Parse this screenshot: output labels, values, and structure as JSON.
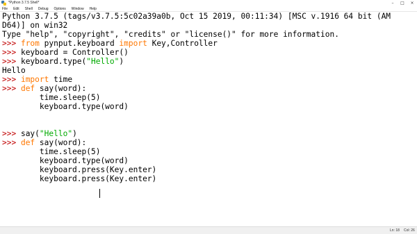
{
  "window": {
    "title": "*Python 3.7.5 Shell*"
  },
  "menu": [
    "File",
    "Edit",
    "Shell",
    "Debug",
    "Options",
    "Window",
    "Help"
  ],
  "colors": {
    "keyword": "#ff7700",
    "string": "#00aa00",
    "prompt": "#c00000",
    "output": "#000000",
    "background": "#ffffff"
  },
  "shell_lines": [
    [
      {
        "t": "Python 3.7.5 (tags/v3.7.5:5c02a39a0b, Oct 15 2019, 00:11:34) [MSC v.1916 64 bit (AM",
        "c": "normal"
      }
    ],
    [
      {
        "t": "D64)] on win32",
        "c": "normal"
      }
    ],
    [
      {
        "t": "Type \"help\", \"copyright\", \"credits\" or \"license()\" for more information.",
        "c": "normal"
      }
    ],
    [
      {
        "t": ">>> ",
        "c": "prompt"
      },
      {
        "t": "from",
        "c": "keyword"
      },
      {
        "t": " pynput.keyboard ",
        "c": "normal"
      },
      {
        "t": "import",
        "c": "keyword"
      },
      {
        "t": " Key,Controller",
        "c": "normal"
      }
    ],
    [
      {
        "t": ">>> ",
        "c": "prompt"
      },
      {
        "t": "keyboard = Controller()",
        "c": "normal"
      }
    ],
    [
      {
        "t": ">>> ",
        "c": "prompt"
      },
      {
        "t": "keyboard.type(",
        "c": "normal"
      },
      {
        "t": "\"Hello\"",
        "c": "string"
      },
      {
        "t": ")",
        "c": "normal"
      }
    ],
    [
      {
        "t": "Hello",
        "c": "normal"
      }
    ],
    [
      {
        "t": ">>> ",
        "c": "prompt"
      },
      {
        "t": "import",
        "c": "keyword"
      },
      {
        "t": " time",
        "c": "normal"
      }
    ],
    [
      {
        "t": ">>> ",
        "c": "prompt"
      },
      {
        "t": "def",
        "c": "keyword"
      },
      {
        "t": " say(word):",
        "c": "normal"
      }
    ],
    [
      {
        "t": "        time.sleep(5)",
        "c": "normal"
      }
    ],
    [
      {
        "t": "        keyboard.type(word)",
        "c": "normal"
      }
    ],
    [],
    [],
    [
      {
        "t": ">>> ",
        "c": "prompt"
      },
      {
        "t": "say(",
        "c": "normal"
      },
      {
        "t": "\"Hello\"",
        "c": "string"
      },
      {
        "t": ")",
        "c": "normal"
      }
    ],
    [
      {
        "t": ">>> ",
        "c": "prompt"
      },
      {
        "t": "def",
        "c": "keyword"
      },
      {
        "t": " say(word):",
        "c": "normal"
      }
    ],
    [
      {
        "t": "        time.sleep(5)",
        "c": "normal"
      }
    ],
    [
      {
        "t": "        keyboard.type(word)",
        "c": "normal"
      }
    ],
    [
      {
        "t": "        keyboard.press(Key.enter)",
        "c": "normal"
      }
    ],
    [
      {
        "t": "        keyboard.press(Key.enter)",
        "c": "normal"
      }
    ]
  ],
  "status": {
    "line": "Ln: 18",
    "col": "Col: 26"
  }
}
